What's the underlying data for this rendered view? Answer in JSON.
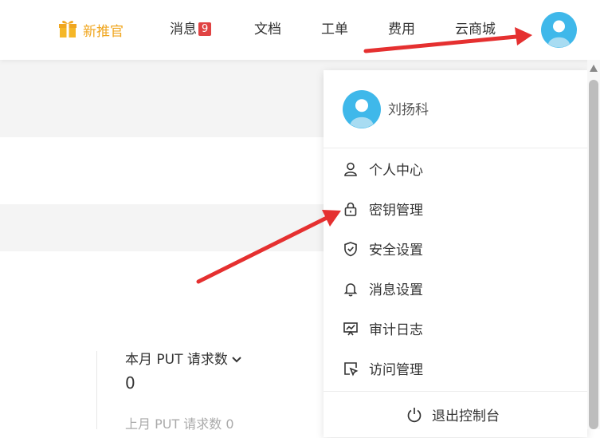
{
  "nav": {
    "promo_label": "新推官",
    "messages_label": "消息",
    "messages_count": "9",
    "docs_label": "文档",
    "tickets_label": "工单",
    "billing_label": "费用",
    "market_label": "云商城"
  },
  "page": {
    "stat_label": "本月 PUT 请求数",
    "stat_value": "0",
    "stat_prev": "上月 PUT 请求数 0"
  },
  "user_menu": {
    "username": "刘扬科",
    "items": [
      {
        "label": "个人中心",
        "icon": "user-icon"
      },
      {
        "label": "密钥管理",
        "icon": "lock-icon"
      },
      {
        "label": "安全设置",
        "icon": "shield-check-icon"
      },
      {
        "label": "消息设置",
        "icon": "bell-icon"
      },
      {
        "label": "审计日志",
        "icon": "monitor-chart-icon"
      },
      {
        "label": "访问管理",
        "icon": "access-cursor-icon"
      }
    ],
    "logout_label": "退出控制台"
  },
  "colors": {
    "promo": "#f0a61f",
    "badge": "#e04343",
    "avatar": "#3fb8ea",
    "annotation_arrow": "#e53030"
  }
}
